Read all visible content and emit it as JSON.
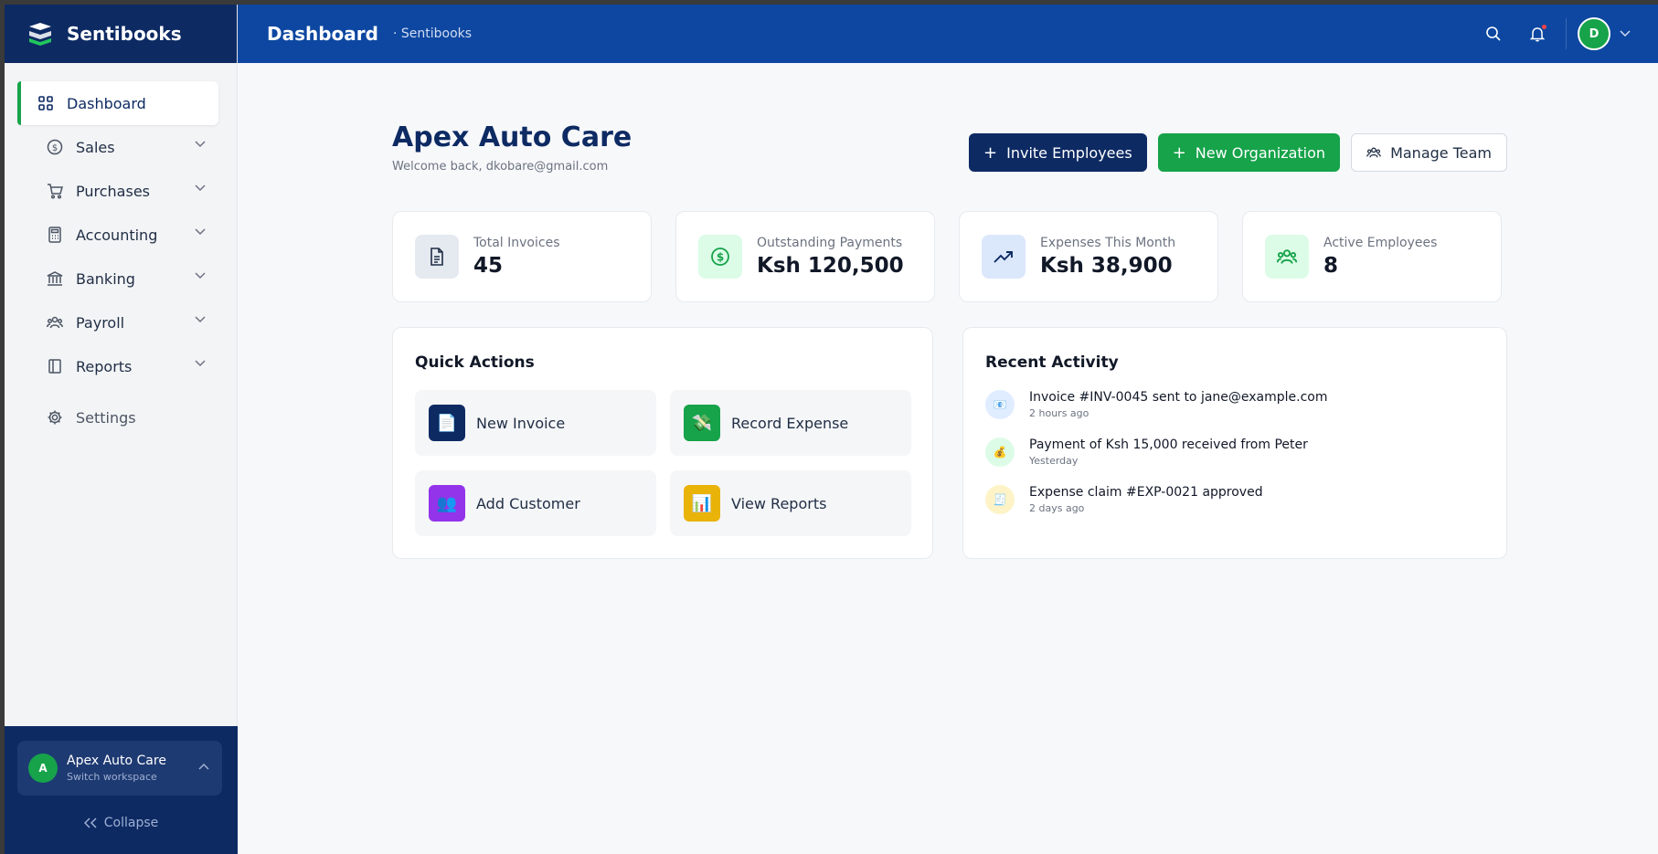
{
  "brand": {
    "name": "Sentibooks"
  },
  "topbar": {
    "title": "Dashboard",
    "breadcrumb": "· Sentibooks",
    "avatar_initial": "D"
  },
  "sidebar": {
    "items": [
      {
        "label": "Dashboard",
        "icon": "grid-icon",
        "active": true
      },
      {
        "label": "Sales",
        "icon": "dollar-icon"
      },
      {
        "label": "Purchases",
        "icon": "cart-icon"
      },
      {
        "label": "Accounting",
        "icon": "calculator-icon"
      },
      {
        "label": "Banking",
        "icon": "bank-icon"
      },
      {
        "label": "Payroll",
        "icon": "users-icon"
      },
      {
        "label": "Reports",
        "icon": "book-icon"
      },
      {
        "label": "Settings",
        "icon": "gear-icon"
      }
    ],
    "workspace": {
      "initial": "A",
      "name": "Apex Auto Care",
      "sub": "Switch workspace"
    },
    "collapse_label": "Collapse"
  },
  "header": {
    "title": "Apex Auto Care",
    "subtitle": "Welcome back, dkobare@gmail.com",
    "buttons": {
      "invite": "Invite Employees",
      "new_org": "New Organization",
      "manage": "Manage Team"
    }
  },
  "stats": [
    {
      "label": "Total Invoices",
      "value": "45",
      "icon": "document-icon"
    },
    {
      "label": "Outstanding Payments",
      "value": "Ksh 120,500",
      "icon": "dollar-circle-icon"
    },
    {
      "label": "Expenses This Month",
      "value": "Ksh 38,900",
      "icon": "trending-up-icon"
    },
    {
      "label": "Active Employees",
      "value": "8",
      "icon": "users-icon"
    }
  ],
  "quick_actions": {
    "title": "Quick Actions",
    "items": [
      {
        "label": "New Invoice",
        "icon": "📄",
        "color": "#0d2a63"
      },
      {
        "label": "Record Expense",
        "icon": "💸",
        "color": "#16a34a"
      },
      {
        "label": "Add Customer",
        "icon": "👥",
        "color": "#9333ea"
      },
      {
        "label": "View Reports",
        "icon": "📊",
        "color": "#eab308"
      }
    ]
  },
  "recent_activity": {
    "title": "Recent Activity",
    "items": [
      {
        "text": "Invoice #INV-0045 sent to jane@example.com",
        "time": "2 hours ago",
        "icon": "📧",
        "bg": "#e0ecff"
      },
      {
        "text": "Payment of Ksh 15,000 received from Peter",
        "time": "Yesterday",
        "icon": "💰",
        "bg": "#dcfce7"
      },
      {
        "text": "Expense claim #EXP-0021 approved",
        "time": "2 days ago",
        "icon": "🧾",
        "bg": "#fef3c7"
      }
    ]
  },
  "colors": {
    "navy": "#0d2a63",
    "topbar": "#0d47a1",
    "green": "#16a34a"
  }
}
